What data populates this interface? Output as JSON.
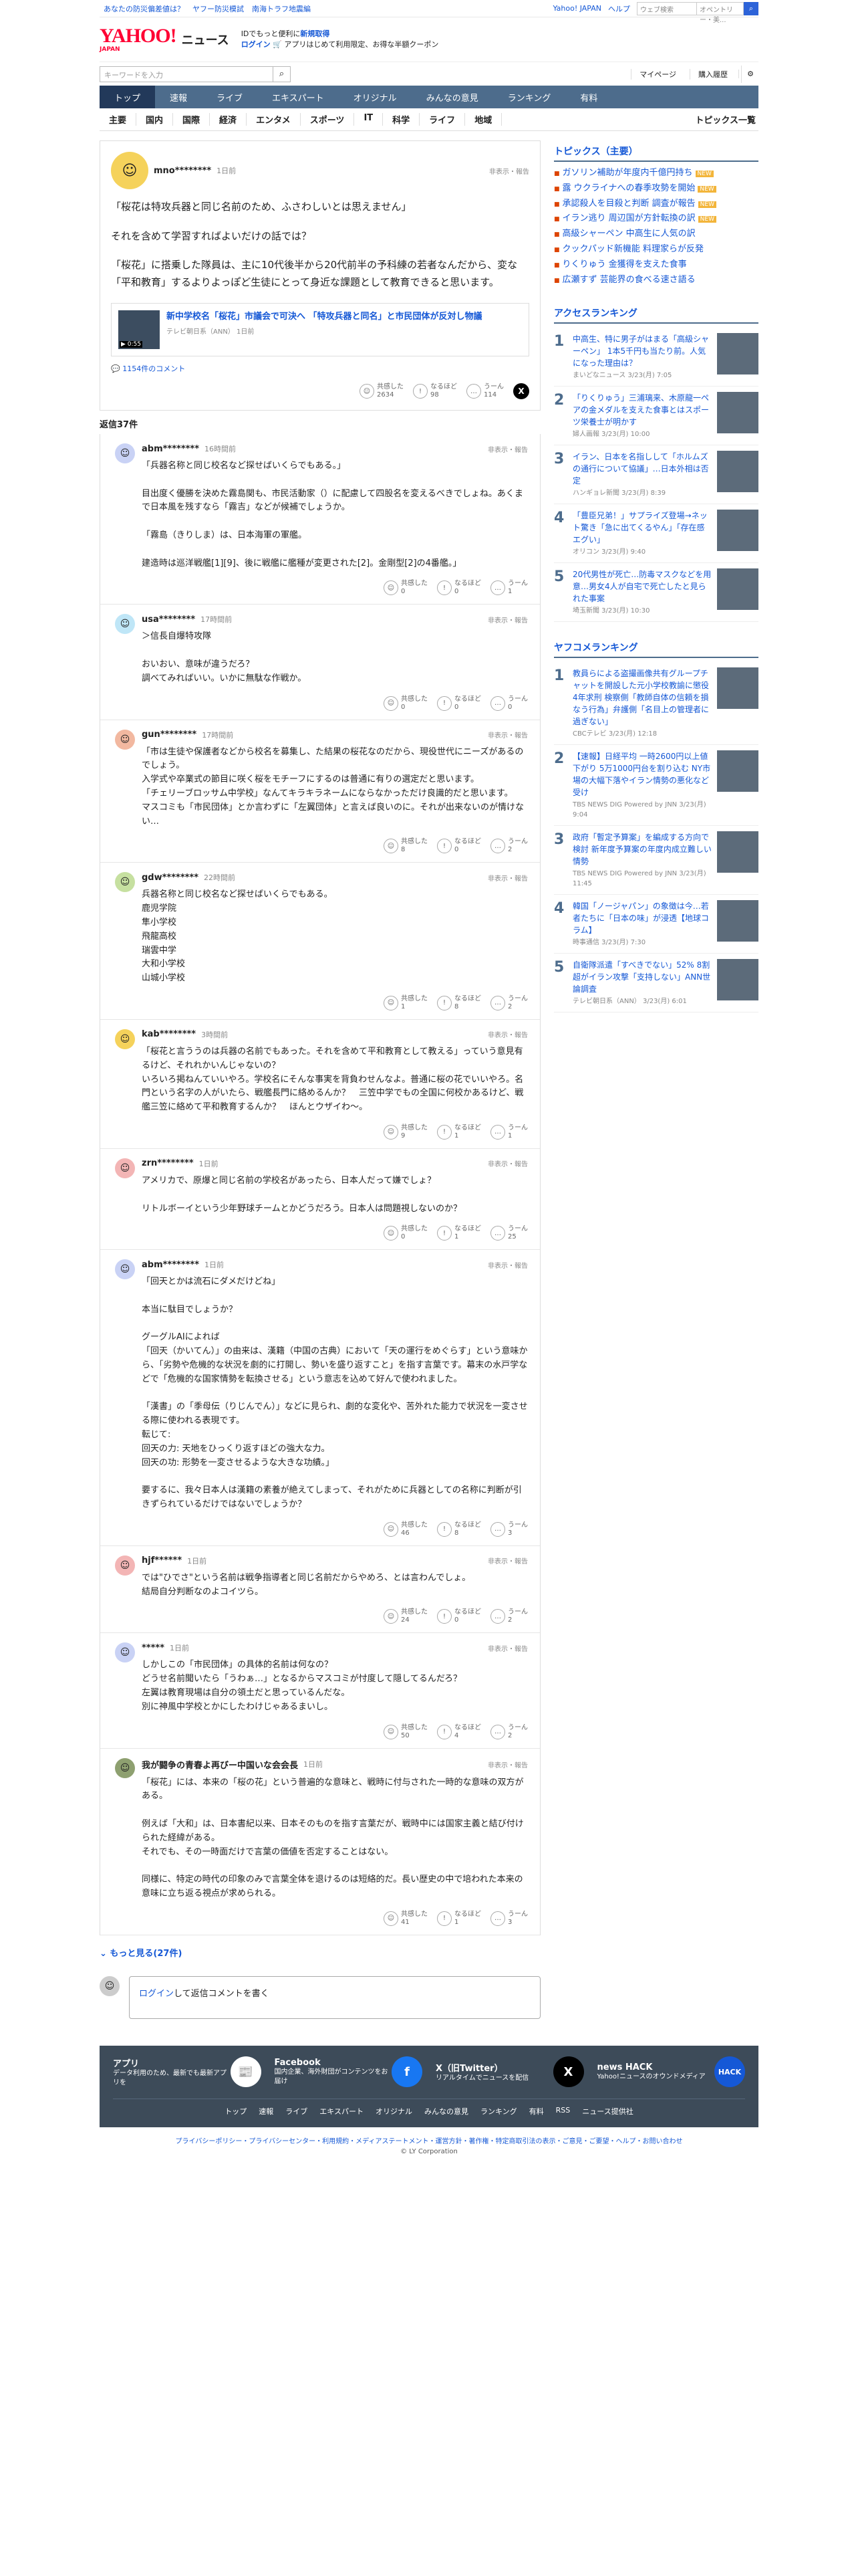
{
  "topbar": {
    "links": [
      "あなたの防災偏差値は？",
      "ヤフー防災模試",
      "南海トラフ地震編"
    ],
    "right": [
      "Yahoo! JAPAN",
      "ヘルプ"
    ],
    "search_placeholder": "ウェブ検索",
    "search_tag": "オペントリー・美..."
  },
  "header": {
    "logo": "YAHOO!",
    "logo_sub": "JAPAN",
    "site": "ニュース",
    "promo_line": "IDでもっと便利に",
    "promo_bold": "新規取得",
    "login": "ログイン",
    "promo2": "🛒 アプリはじめて利用限定、お得な半額クーポン"
  },
  "search": {
    "placeholder": "キーワードを入力",
    "mypage": "マイページ",
    "purchase": "購入履歴"
  },
  "nav": [
    "トップ",
    "速報",
    "ライブ",
    "エキスパート",
    "オリジナル",
    "みんなの意見",
    "ランキング",
    "有料"
  ],
  "cats": [
    "主要",
    "国内",
    "国際",
    "経済",
    "エンタメ",
    "スポーツ",
    "IT",
    "科学",
    "ライフ",
    "地域"
  ],
  "cats_right": "トピックス一覧",
  "top_comment": {
    "user": "mno********",
    "time": "1日前",
    "hide": "非表示・報告",
    "paras": [
      "「桜花は特攻兵器と同じ名前のため、ふさわしいとは思えません」",
      "それを含めて学習すればよいだけの話では？",
      "「桜花」に搭乗した隊員は、主に10代後半から20代前半の予科練の若者なんだから、変な「平和教育」するよりよっぽど生徒にとって身近な課題として教育できると思います。"
    ],
    "article_title": "新中学校名「桜花」市議会で可決へ 「特攻兵器と同名」と市民団体が反対し物議",
    "article_src": "テレビ朝日系（ANN） 1日前",
    "video": "▶ 0:55",
    "comment_link": "1154件のコメント",
    "r1": "共感した",
    "r1n": "2634",
    "r2": "なるほど",
    "r2n": "98",
    "r3": "うーん",
    "r3n": "114"
  },
  "reply_count_label": "返信37件",
  "labels": {
    "kyokan": "共感した",
    "naruhodo": "なるほど",
    "uun": "うーん",
    "hide": "非表示・報告"
  },
  "replies": [
    {
      "user": "abm********",
      "time": "16時間前",
      "text": "「兵器名称と同じ校名など探せばいくらでもある。」\n\n目出度く優勝を決めた霧島関も、市民活動家（）に配慮して四股名を変えるべきでしょね。あくまで日本風を残すなら「霧吉」などが候補でしょうか。\n\n「霧島（きりしま）は、日本海軍の軍艦。\n\n建造時は巡洋戦艦[1][9]、後に戦艦に艦種が変更された[2]。金剛型[2]の4番艦。」",
      "a": "0",
      "b": "0",
      "c": "1",
      "color": "#c9d2f5"
    },
    {
      "user": "usa********",
      "time": "17時間前",
      "text": "＞信長自爆特攻隊\n\nおいおい、意味が違うだろ？\n調べてみればいい。いかに無駄な作戦か。",
      "a": "0",
      "b": "0",
      "c": "0",
      "color": "#bfe6f7"
    },
    {
      "user": "gun********",
      "time": "17時間前",
      "text": "「市は生徒や保護者などから校名を募集し、た結果の桜花なのだから、現役世代にニーズがあるのでしょう。\n入学式や卒業式の節目に咲く桜をモチーフにするのは普通に有りの選定だと思います。\n「チェリーブロッサム中学校」なんてキラキラネームにならなかっただけ良識的だと思います。\nマスコミも「市民団体」とか言わずに「左翼団体」と言えば良いのに。それが出来ないのが情けない…",
      "a": "8",
      "b": "0",
      "c": "2",
      "color": "#f2b8a0"
    },
    {
      "user": "gdw********",
      "time": "22時間前",
      "text": "兵器名称と同じ校名など探せばいくらでもある。\n鹿児学院\n隼小学校\n飛龍高校\n瑞雲中学\n大和小学校\n山城小学校",
      "a": "1",
      "b": "8",
      "c": "2",
      "color": "#c6e0a0"
    },
    {
      "user": "kab********",
      "time": "3時間前",
      "text": "「桜花と言ううのは兵器の名前でもあった。それを含めて平和教育として教える」っていう意見有るけど、それれかいんじゃないの？\nいろいろ掲ねんていいやろ。学校名にそんな事実を背負わせんなよ。普通に桜の花でいいやろ。名門という名字の人がいたら、戦艦長門に絡めるんか？　三笠中学でもの全国に何校かあるけど、戦艦三笠に絡めて平和教育するんか？　ほんとウザイわ〜。",
      "a": "9",
      "b": "1",
      "c": "1",
      "color": "#f5d25b"
    },
    {
      "user": "zrn********",
      "time": "1日前",
      "text": "アメリカで、原爆と同じ名前の学校名があったら、日本人だって嫌でしょ？\n\nリトルボーイという少年野球チームとかどうだろう。日本人は問題視しないのか？",
      "a": "0",
      "b": "1",
      "c": "25",
      "color": "#f3b5b5"
    },
    {
      "user": "abm********",
      "time": "1日前",
      "text": "「回天とかは流石にダメだけどね」\n\n本当に駄目でしょうか？\n\nグーグルAIによれば\n「回天（かいてん）」の由来は、漢籍（中国の古典）において「天の運行をめぐらす」という意味から、「劣勢や危機的な状況を劇的に打開し、勢いを盛り返すこと」を指す言葉です。幕末の水戸学などで「危機的な国家情勢を転換させる」という意志を込めて好んで使われました。\n\n「漢書」の「季母伝（りじんでん）」などに見られ、劇的な変化や、苦外れた能力で状況を一変させる際に使われる表現です。\n転じて:\n回天の力: 天地をひっくり返すほどの強大な力。\n回天の功: 形勢を一変させるような大きな功績。」\n\n要するに、我々日本人は漢籍の素養が絶えてしまって、それがために兵器としての名称に判断が引きずられているだけではないでしょうか？",
      "a": "46",
      "b": "8",
      "c": "3",
      "color": "#c9d2f5"
    },
    {
      "user": "hjf******",
      "time": "1日前",
      "text": "では\"ひでさ\"という名前は戦争指導者と同じ名前だからやめろ、とは言わんでしょ。\n結局自分判断なのよコイツら。",
      "a": "24",
      "b": "0",
      "c": "2",
      "color": "#f3b5b5"
    },
    {
      "user": "*****",
      "time": "1日前",
      "text": "しかしこの「市民団体」の具体的名前は何なの？\nどうせ名前聞いたら「うわぁ…」となるからマスコミが忖度して隠してるんだろ？\n左翼は教育現場は自分の領土だと思っているんだな。\n別に神風中学校とかにしたわけじゃあるまいし。",
      "a": "50",
      "b": "4",
      "c": "2",
      "color": "#c9d2f5"
    },
    {
      "user": "我が闘争の青春よ再びー中国いな会会長",
      "time": "1日前",
      "text": "「桜花」には、本来の「桜の花」という普遍的な意味と、戦時に付与された一時的な意味の双方がある。\n\n例えば「大和」は、日本書紀以来、日本そのものを指す言葉だが、戦時中には国家主義と結び付けられた経緯がある。\nそれでも、その一時面だけで言葉の価値を否定することはない。\n\n同様に、特定の時代の印象のみで言葉全体を退けるのは短絡的だ。長い歴史の中で培われた本来の意味に立ち返る視点が求められる。",
      "a": "41",
      "b": "1",
      "c": "3",
      "color": "#8ea070"
    }
  ],
  "more": "もっと見る(27件)",
  "post_placeholder_login": "ログイン",
  "post_placeholder_rest": "して返信コメントを書く",
  "side": {
    "topics_title": "トピックス（主要）",
    "topics": [
      "ガソリン補助が年度内千億円持ち",
      "露 ウクライナへの春季攻勢を開始",
      "承認殺人を目殺と判断 調査が報告",
      "イラン逃り 周辺国が方針転換の訳",
      "高級シャーペン 中高生に人気の訳",
      "クックパッド新機能 料理家らが反発",
      "りくりゅう 金獲得を支えた食事",
      "広瀬すず 芸能界の食べる速さ語る"
    ],
    "new": "NEW",
    "access_title": "アクセスランキング",
    "access": [
      {
        "no": "1",
        "t": "中高生、特に男子がはまる「高級シャーペン」 1本5千円も当たり前。人気になった理由は？",
        "s": "まいどなニュース 3/23(月) 7:05"
      },
      {
        "no": "2",
        "t": "「りくりゅう」三浦璃来、木原龍一ペアの金メダルを支えた食事とはスポーツ栄養士が明かす",
        "s": "婦人画報 3/23(月) 10:00"
      },
      {
        "no": "3",
        "t": "イラン、日本を名指しして「ホルムズの通行について協議」…日本外相は否定",
        "s": "ハンギョレ新聞 3/23(月) 8:39"
      },
      {
        "no": "4",
        "t": "「豊臣兄弟！」サプライズ登場→ネット驚き「急に出てくるやん」「存在感エグい」",
        "s": "オリコン 3/23(月) 9:40"
      },
      {
        "no": "5",
        "t": "20代男性が死亡…防毒マスクなどを用意…男女4人が自宅で死亡したと見られた事案",
        "s": "埼玉新聞 3/23(月) 10:30"
      }
    ],
    "yafoo_title": "ヤフコメランキング",
    "yafoo": [
      {
        "no": "1",
        "t": "教員らによる盗撮画像共有グループチャットを開設した元小学校教諭に懲役4年求刑 検察側「教師自体の信頼を損なう行為」弁護側「名目上の管理者に過ぎない」",
        "s": "CBCテレビ 3/23(月) 12:18"
      },
      {
        "no": "2",
        "t": "【速報】日経平均 一時2600円以上値下がり 5万1000円台を割り込む NY市場の大幅下落やイラン情勢の悪化など受け",
        "s": "TBS NEWS DIG Powered by JNN 3/23(月) 9:04"
      },
      {
        "no": "3",
        "t": "政府「暫定予算案」を編成する方向で検討 新年度予算案の年度内成立難しい情勢",
        "s": "TBS NEWS DIG Powered by JNN 3/23(月) 11:45"
      },
      {
        "no": "4",
        "t": "韓国「ノージャパン」の象徴は今…若者たちに「日本の味」が浸透【地球コラム】",
        "s": "時事通信 3/23(月) 7:30"
      },
      {
        "no": "5",
        "t": "自衛隊派遣「すべきでない」52% 8割超がイラン攻撃「支持しない」ANN世論調査",
        "s": "テレビ朝日系（ANN） 3/23(月) 6:01"
      }
    ]
  },
  "footer": {
    "cols": [
      {
        "t": "アプリ",
        "d": "データ利用のため、最新でも最新アプリを",
        "i": "📰"
      },
      {
        "t": "Facebook",
        "d": "国内企業、海外財団がコンテンツをお届け",
        "i": "f"
      },
      {
        "t": "X（旧Twitter）",
        "d": "リアルタイムでニュースを配信",
        "i": "X"
      },
      {
        "t": "news HACK",
        "d": "Yahoo!ニュースのオウンドメディア",
        "i": "HACK"
      }
    ],
    "nav": [
      "トップ",
      "速報",
      "ライブ",
      "エキスパート",
      "オリジナル",
      "みんなの意見",
      "ランキング",
      "有料",
      "RSS",
      "ニュース提供社"
    ],
    "legal": "プライバシーポリシー・プライバシーセンター・利用規約・メディアステートメント・運営方針・著作権・特定商取引法の表示・ご意見・ご要望・ヘルプ・お問い合わせ",
    "copy": "© LY Corporation"
  },
  "colors": {
    "nav": "#4d6c8c",
    "nav_active": "#22395a",
    "link": "#1558d6",
    "logo": "#ff0033"
  }
}
